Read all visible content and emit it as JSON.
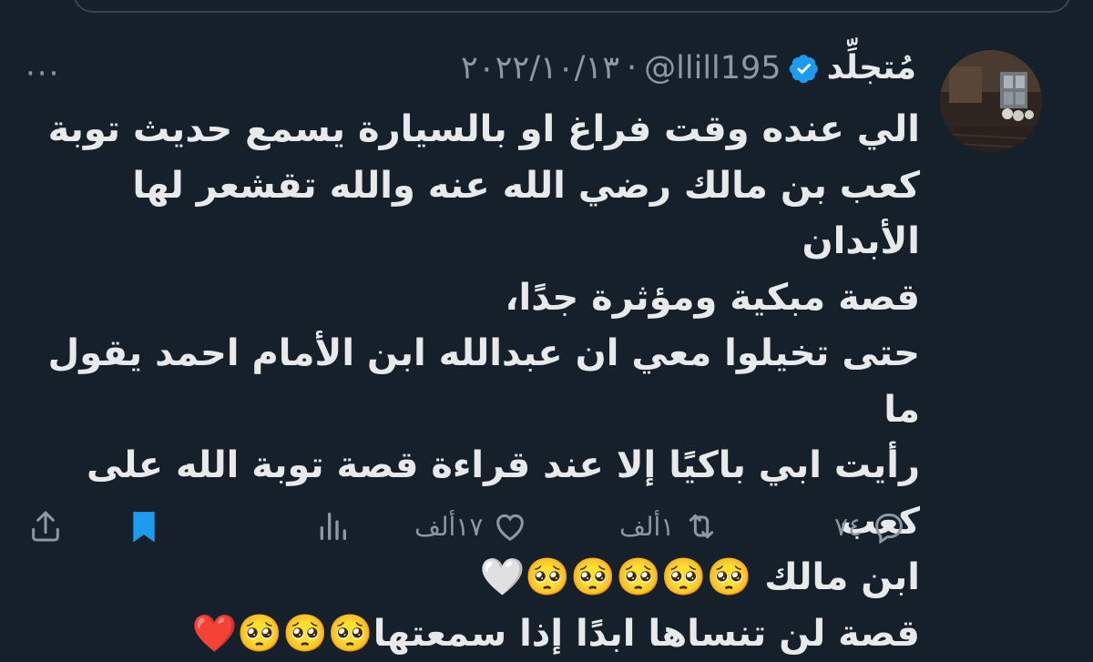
{
  "tweet": {
    "display_name": "مُتجلِّد",
    "handle": "@llill195",
    "separator": "·",
    "date": "٢٠٢٢/١٠/١٣",
    "more_label": "···",
    "body": "الي عنده وقت فراغ او بالسيارة يسمع حديث توبة\nكعب بن مالك رضي الله عنه والله تقشعر لها الأبدان\nقصة مبكية ومؤثرة جدًا،\nحتى تخيلوا معي ان عبدالله ابن الأمام احمد يقول ما\nرأيت ابي باكيًا إلا عند قراءة قصة توبة الله على كعب\nابن مالك 🥺🥺🥺🥺🥺🤍\nقصة لن تنساها ابدًا إذا سمعتها🥺🥺🥺❤️"
  },
  "actions": {
    "reply_count": "٧٤",
    "retweet_count": "١ألف",
    "like_count": "١٧ألف"
  },
  "colors": {
    "background": "#15202b",
    "text": "#e7e9ea",
    "muted": "#8b98a5",
    "accent": "#1d9bf0"
  },
  "icons": [
    "verified-badge-icon",
    "more-icon",
    "reply-icon",
    "retweet-icon",
    "like-icon",
    "views-icon",
    "bookmark-icon",
    "share-icon"
  ]
}
